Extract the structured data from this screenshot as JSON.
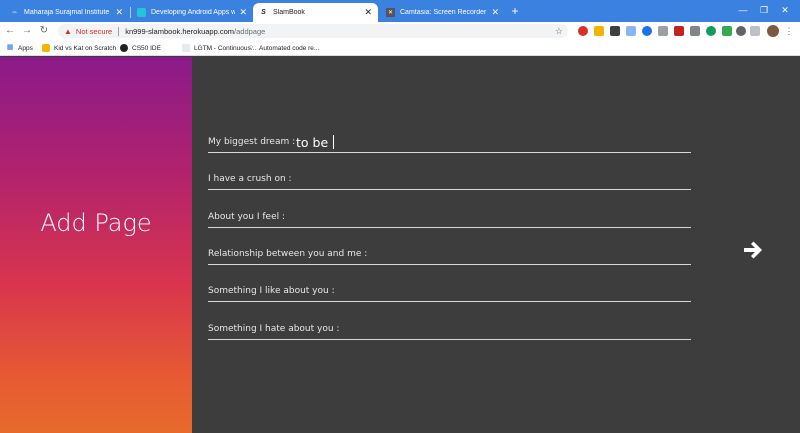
{
  "tabs": [
    {
      "title": "Maharaja Surajmal Institute of Te...",
      "icon": "link-icon",
      "active": false
    },
    {
      "title": "Developing Android Apps with K...",
      "icon": "course-icon",
      "active": false
    },
    {
      "title": "SlamBook",
      "icon": "slambook-icon",
      "active": true
    },
    {
      "title": "Camtasia: Screen Recorder & Vi...",
      "icon": "camtasia-icon",
      "active": false
    }
  ],
  "address": {
    "security": "Not secure",
    "host": "kn999-slambook.herokuapp.com",
    "path": "/addpage"
  },
  "bookmarks": [
    {
      "label": "Apps",
      "icon": "apps-grid-icon"
    },
    {
      "label": "Kid vs Kat on Scratch",
      "icon": "scratch-icon"
    },
    {
      "label": "CS50 IDE",
      "icon": "cs50-icon"
    },
    {
      "label": "LGTM - Continuous...",
      "icon": "lgtm-icon"
    },
    {
      "label": "Automated code re...",
      "icon": "code-review-icon"
    }
  ],
  "page": {
    "title": "Add Page",
    "fields": [
      {
        "label": "My biggest dream :",
        "value": "to be"
      },
      {
        "label": "I have a crush on :",
        "value": ""
      },
      {
        "label": "About you I feel :",
        "value": ""
      },
      {
        "label": "Relationship between you and me :",
        "value": ""
      },
      {
        "label": "Something I like about you :",
        "value": ""
      },
      {
        "label": "Something I hate about you :",
        "value": ""
      }
    ],
    "next_icon": "arrow-right-icon"
  },
  "colors": {
    "tabstrip": "#3b82e0",
    "content_bg": "#3d3d3e",
    "gradient_top": "#8a1a8a",
    "gradient_bottom": "#e76a2b"
  }
}
